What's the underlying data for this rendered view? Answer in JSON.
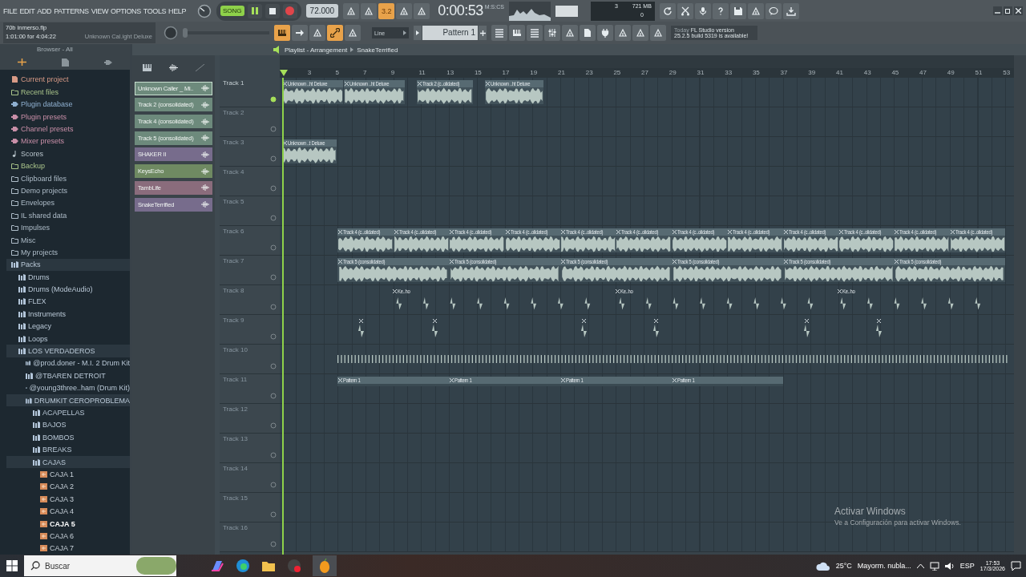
{
  "menu": [
    "FILE",
    "EDIT",
    "ADD",
    "PATTERNS",
    "VIEW",
    "OPTIONS",
    "TOOLS",
    "HELP"
  ],
  "transport": {
    "mode": "SONG",
    "song_selected": true,
    "tempo": "72.000"
  },
  "beat_indicator": "3.2",
  "time": {
    "value": "0:00:53",
    "unit": "M:S:CS"
  },
  "cpu": {
    "cpu": "3",
    "memory": "721 MB",
    "polyphony": "0"
  },
  "project": {
    "file": "70b inmerso.flp",
    "position": "1:01:00 for 4:04:22",
    "hint": "Unknown Cal.ight Deluxe"
  },
  "master_volume": {
    "level": 0
  },
  "snap": "Line",
  "pattern": "Pattern 1",
  "news": {
    "label": "Today",
    "title": "FL Studio version",
    "body": "25.2.5 build 5319 is available!"
  },
  "browser": {
    "title": "Browser - All",
    "items": [
      {
        "label": "Current project",
        "kind": "project",
        "selected": false
      },
      {
        "label": "Recent files",
        "kind": "recent",
        "selected": false
      },
      {
        "label": "Plugin database",
        "kind": "plugin",
        "selected": false
      },
      {
        "label": "Plugin presets",
        "kind": "preset",
        "selected": false
      },
      {
        "label": "Channel presets",
        "kind": "preset",
        "selected": false
      },
      {
        "label": "Mixer presets",
        "kind": "preset",
        "selected": false
      },
      {
        "label": "Scores",
        "kind": "score",
        "selected": false
      },
      {
        "label": "Backup",
        "kind": "recent",
        "selected": false
      },
      {
        "label": "Clipboard files",
        "kind": "folder",
        "selected": false
      },
      {
        "label": "Demo projects",
        "kind": "folder",
        "selected": false
      },
      {
        "label": "Envelopes",
        "kind": "folder",
        "selected": false
      },
      {
        "label": "IL shared data",
        "kind": "folder",
        "selected": false
      },
      {
        "label": "Impulses",
        "kind": "folder",
        "selected": false
      },
      {
        "label": "Misc",
        "kind": "folder",
        "selected": false
      },
      {
        "label": "My projects",
        "kind": "folder",
        "selected": false
      },
      {
        "label": "Packs",
        "kind": "pack",
        "selected": false,
        "expanded": true,
        "children": [
          {
            "label": "Drums",
            "kind": "pack",
            "selected": false
          },
          {
            "label": "Drums (ModeAudio)",
            "kind": "pack",
            "selected": false
          },
          {
            "label": "FLEX",
            "kind": "pack",
            "selected": false
          },
          {
            "label": "Instruments",
            "kind": "pack",
            "selected": false
          },
          {
            "label": "Legacy",
            "kind": "pack",
            "selected": false
          },
          {
            "label": "Loops",
            "kind": "pack",
            "selected": false
          },
          {
            "label": "LOS VERDADEROS",
            "kind": "pack",
            "selected": false,
            "expanded": true,
            "children": [
              {
                "label": "@prod.doner - M.I. 2 Drum Kit",
                "kind": "pack",
                "selected": false
              },
              {
                "label": "@TBAREN DETROIT",
                "kind": "pack",
                "selected": false
              },
              {
                "label": "@young3three..ham (Drum Kit)",
                "kind": "pack",
                "selected": false
              },
              {
                "label": "DRUMKIT CEROPROBLEMA",
                "kind": "pack",
                "selected": false,
                "expanded": true,
                "children": [
                  {
                    "label": "ACAPELLAS",
                    "kind": "pack",
                    "selected": false
                  },
                  {
                    "label": "BAJOS",
                    "kind": "pack",
                    "selected": false
                  },
                  {
                    "label": "BOMBOS",
                    "kind": "pack",
                    "selected": false
                  },
                  {
                    "label": "BREAKS",
                    "kind": "pack",
                    "selected": false
                  },
                  {
                    "label": "CAJAS",
                    "kind": "pack",
                    "selected": false,
                    "expanded": true,
                    "children": [
                      {
                        "label": "CAJA 1",
                        "kind": "sample",
                        "selected": false
                      },
                      {
                        "label": "CAJA 2",
                        "kind": "sample",
                        "selected": false
                      },
                      {
                        "label": "CAJA 3",
                        "kind": "sample",
                        "selected": false
                      },
                      {
                        "label": "CAJA 4",
                        "kind": "sample",
                        "selected": false
                      },
                      {
                        "label": "CAJA 5",
                        "kind": "sample",
                        "selected": true
                      },
                      {
                        "label": "CAJA 6",
                        "kind": "sample",
                        "selected": false
                      },
                      {
                        "label": "CAJA 7",
                        "kind": "sample",
                        "selected": false
                      }
                    ]
                  }
                ]
              }
            ]
          }
        ]
      }
    ]
  },
  "channels": [
    {
      "name": "Unknown Caller _ Mi..",
      "color": "#6d8a7c",
      "selected": true
    },
    {
      "name": "Track 2 (consolidated)",
      "color": "#6d8a7c",
      "selected": false
    },
    {
      "name": "Track 4 (consolidated)",
      "color": "#6d8a7c",
      "selected": false
    },
    {
      "name": "Track 5 (consolidated)",
      "color": "#6d8a7c",
      "selected": false
    },
    {
      "name": "SHAKER II",
      "color": "#776c8c",
      "selected": false
    },
    {
      "name": "KeysEcho",
      "color": "#6f8a62",
      "selected": false
    },
    {
      "name": "TambLife",
      "color": "#8a6c7c",
      "selected": false
    },
    {
      "name": "SnakeTerrified",
      "color": "#776c8c",
      "selected": false
    }
  ],
  "playlist": {
    "title": "Playlist - Arrangement",
    "pattern": "SnakeTerrified",
    "ruler": [
      "3",
      "5",
      "7",
      "9",
      "11",
      "13",
      "15",
      "17",
      "19",
      "21",
      "23",
      "25",
      "27",
      "29",
      "31",
      "33",
      "35",
      "37",
      "39",
      "41",
      "43",
      "45",
      "47",
      "49",
      "51",
      "53"
    ],
    "tracks": [
      {
        "name": "Track 1",
        "selected": true,
        "clips": [
          {
            "kind": "audio",
            "label": "Unknown ..ht Deluxe"
          },
          {
            "kind": "audio",
            "label": "Unknown ..ht Deluxe"
          },
          {
            "kind": "audio",
            "label": "Track 2 (c..olidated)"
          },
          {
            "kind": "audio",
            "label": "Unknown ..ht Deluxe"
          }
        ]
      },
      {
        "name": "Track 2",
        "selected": false
      },
      {
        "name": "Track 3",
        "selected": false,
        "clips": [
          {
            "kind": "audio",
            "label": "Unknown ..t Deluxe"
          }
        ]
      },
      {
        "name": "Track 4",
        "selected": false
      },
      {
        "name": "Track 5",
        "selected": false
      },
      {
        "name": "Track 6",
        "selected": false,
        "clips": [
          {
            "kind": "audio",
            "label": "Track 4 (c..olidated)"
          },
          {
            "kind": "audio",
            "label": "Track 4 (c..olidated)"
          },
          {
            "kind": "audio",
            "label": "Track 4 (c..olidated)"
          },
          {
            "kind": "audio",
            "label": "Track 4 (c..olidated)"
          },
          {
            "kind": "audio",
            "label": "Track 4 (c..olidated)"
          },
          {
            "kind": "audio",
            "label": "Track 4 (c..olidated)"
          },
          {
            "kind": "audio",
            "label": "Track 4 (c..olidated)"
          },
          {
            "kind": "audio",
            "label": "Track 4 (c..olidated)"
          },
          {
            "kind": "audio",
            "label": "Track 4 (c..olidated)"
          },
          {
            "kind": "audio",
            "label": "Track 4 (c..olidated)"
          },
          {
            "kind": "audio",
            "label": "Track 4 (c..olidated)"
          },
          {
            "kind": "audio",
            "label": "Track 4 (c..olidated)"
          }
        ]
      },
      {
        "name": "Track 7",
        "selected": false,
        "clips": [
          {
            "kind": "audio",
            "label": "Track 5 (consolidated)"
          },
          {
            "kind": "audio",
            "label": "Track 5 (consolidated)"
          },
          {
            "kind": "audio",
            "label": "Track 5 (consolidated)"
          },
          {
            "kind": "audio",
            "label": "Track 5 (consolidated)"
          },
          {
            "kind": "audio",
            "label": "Track 5 (consolidated)"
          },
          {
            "kind": "audio",
            "label": "Track 5 (consolidated)"
          }
        ]
      },
      {
        "name": "Track 8",
        "selected": false,
        "clips": [
          {
            "kind": "hits",
            "label": "Ke..ho"
          },
          {
            "kind": "hits",
            "label": "Ke..ho"
          },
          {
            "kind": "hits",
            "label": "Ke..ho"
          }
        ]
      },
      {
        "name": "Track 9",
        "selected": false,
        "clips": [
          {
            "kind": "hit"
          },
          {
            "kind": "hit"
          },
          {
            "kind": "hit"
          },
          {
            "kind": "hit"
          },
          {
            "kind": "hit"
          },
          {
            "kind": "hit"
          }
        ]
      },
      {
        "name": "Track 10",
        "selected": false,
        "clips": [
          {
            "kind": "pulses"
          }
        ]
      },
      {
        "name": "Track 11",
        "selected": false,
        "clips": [
          {
            "kind": "pattern",
            "label": "Pattern 1"
          },
          {
            "kind": "pattern",
            "label": "Pattern 1"
          },
          {
            "kind": "pattern",
            "label": "Pattern 1"
          },
          {
            "kind": "pattern",
            "label": "Pattern 1"
          }
        ]
      },
      {
        "name": "Track 12",
        "selected": false
      },
      {
        "name": "Track 13",
        "selected": false
      },
      {
        "name": "Track 14",
        "selected": false
      },
      {
        "name": "Track 15",
        "selected": false
      },
      {
        "name": "Track 16",
        "selected": false
      }
    ]
  },
  "taskbar": {
    "search": "Buscar",
    "weather": "25°C",
    "forecast": "Mayorm. nubla...",
    "language": "ESP",
    "time": "17:53",
    "date": "17/3/2026"
  },
  "activation": {
    "title": "Activar Windows",
    "body": "Ve a Configuración para activar Windows."
  }
}
